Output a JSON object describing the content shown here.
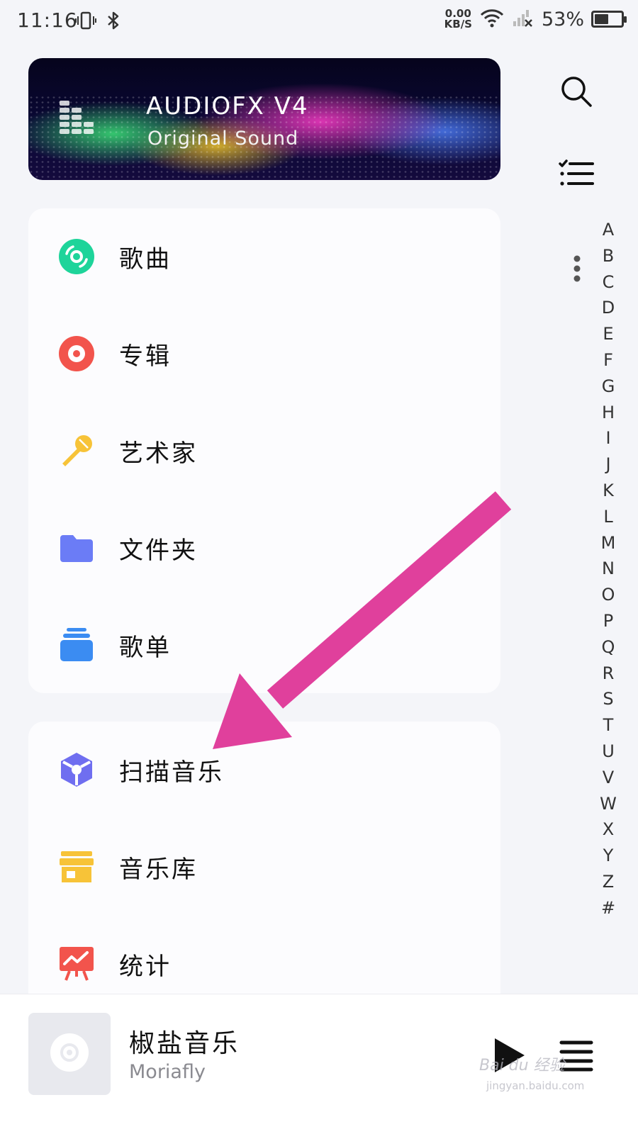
{
  "status_bar": {
    "time": "11:16",
    "net_speed_value": "0.00",
    "net_speed_unit": "KB/S",
    "battery_percent": "53%",
    "battery_level": 0.53
  },
  "banner": {
    "title": "AUDIOFX V4",
    "subtitle": "Original Sound"
  },
  "library_menu": [
    {
      "label": "歌曲",
      "icon": "disc-icon",
      "color": "#1ed49a"
    },
    {
      "label": "专辑",
      "icon": "album-icon",
      "color": "#f2544c"
    },
    {
      "label": "艺术家",
      "icon": "microphone-icon",
      "color": "#f7c338"
    },
    {
      "label": "文件夹",
      "icon": "folder-icon",
      "color": "#6b7cf6"
    },
    {
      "label": "歌单",
      "icon": "playlist-stack-icon",
      "color": "#3b8cf2"
    }
  ],
  "tools_menu": [
    {
      "label": "扫描音乐",
      "icon": "scan-cube-icon",
      "color": "#6f6ef0"
    },
    {
      "label": "音乐库",
      "icon": "store-icon",
      "color": "#f7c338"
    },
    {
      "label": "统计",
      "icon": "stats-board-icon",
      "color": "#f2544c"
    }
  ],
  "alphabet_index": [
    "A",
    "B",
    "C",
    "D",
    "E",
    "F",
    "G",
    "H",
    "I",
    "J",
    "K",
    "L",
    "M",
    "N",
    "O",
    "P",
    "Q",
    "R",
    "S",
    "T",
    "U",
    "V",
    "W",
    "X",
    "Y",
    "Z",
    "#"
  ],
  "now_playing": {
    "title": "椒盐音乐",
    "artist": "Moriafly"
  },
  "watermark": {
    "text": "Bai du 经验",
    "url": "jingyan.baidu.com"
  },
  "colors": {
    "background": "#f4f5f9",
    "card": "#fcfcfe",
    "annotation_arrow": "#e0409c"
  }
}
